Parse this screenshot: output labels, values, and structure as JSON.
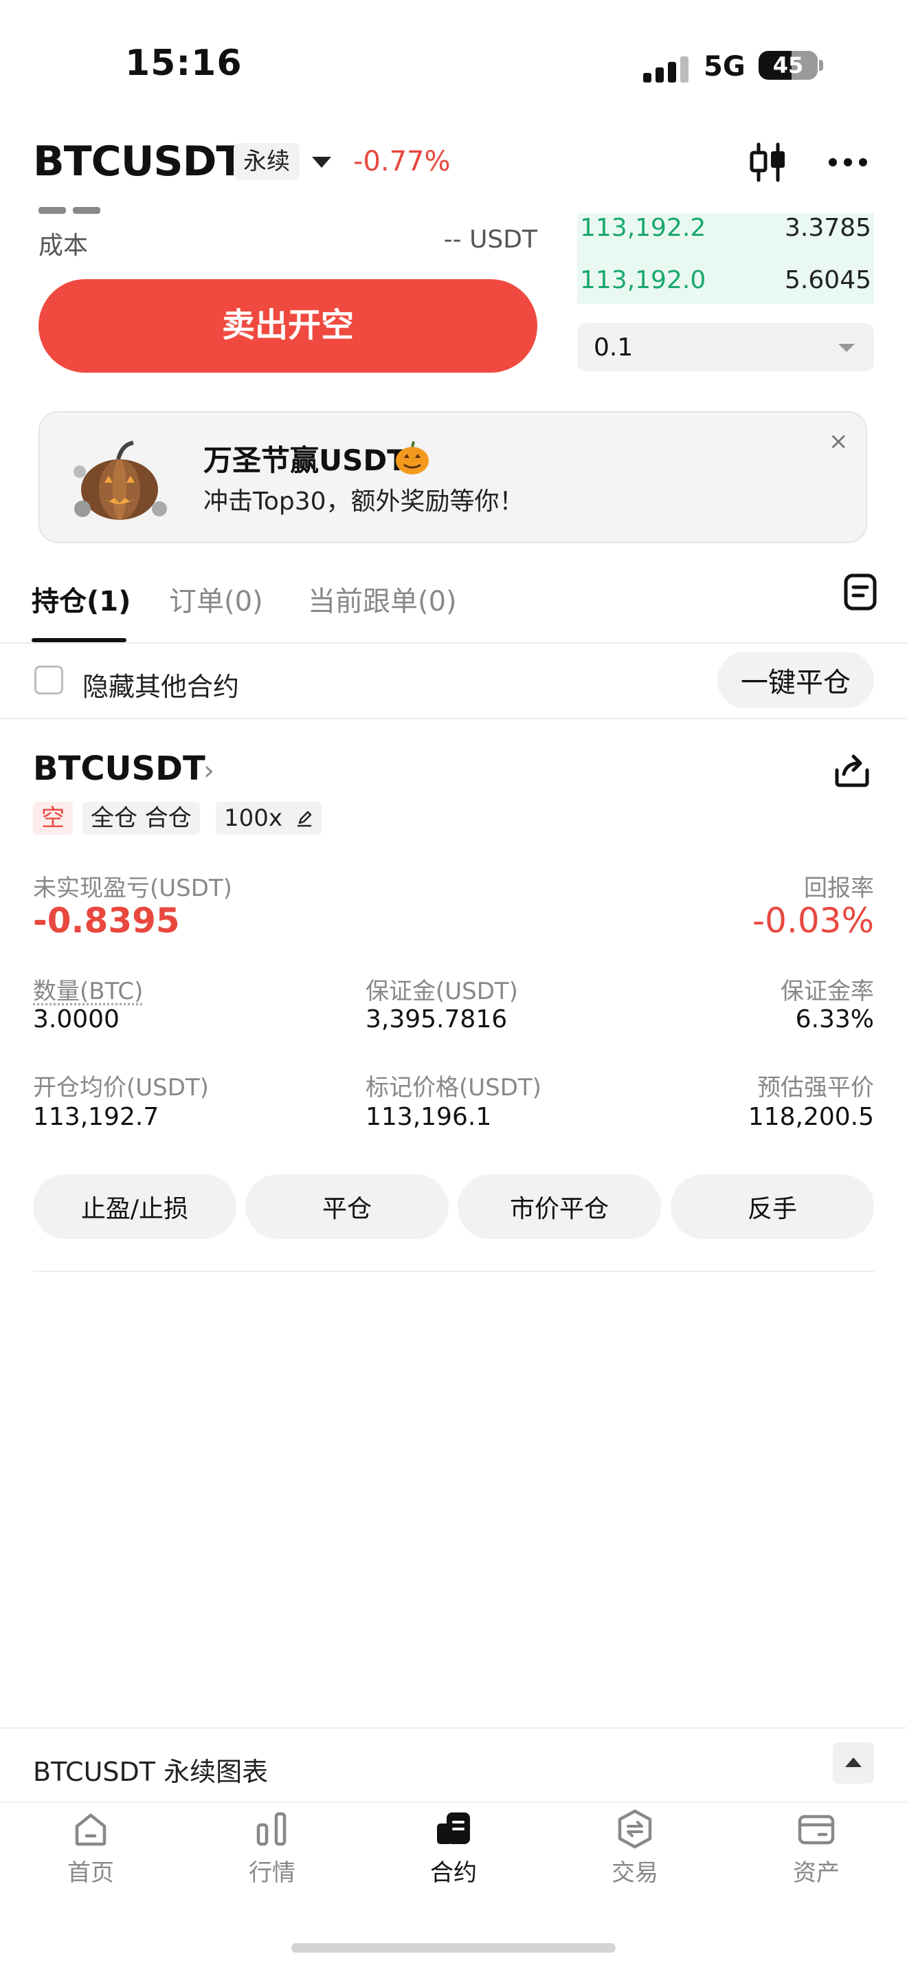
{
  "status_bar": {
    "time": "15:16",
    "network": "5G",
    "battery": "45"
  },
  "header": {
    "symbol": "BTCUSDT",
    "contract_type": "永续",
    "change": "-0.77%"
  },
  "trade_panel": {
    "cost_label": "成本",
    "cost_value": "-- USDT",
    "sell_button": "卖出开空",
    "order_book": [
      {
        "price": "113,192.2",
        "qty": "3.3785"
      },
      {
        "price": "113,192.0",
        "qty": "5.6045"
      }
    ],
    "precision_value": "0.1"
  },
  "banner": {
    "title": "万圣节赢USDT",
    "subtitle": "冲击Top30，额外奖励等你！",
    "close": "×"
  },
  "tabs": [
    {
      "label": "持仓(1)",
      "active": true
    },
    {
      "label": "订单(0)",
      "active": false
    },
    {
      "label": "当前跟单(0)",
      "active": false
    }
  ],
  "filter": {
    "hide_other_label": "隐藏其他合约",
    "close_all_button": "一键平仓"
  },
  "position": {
    "symbol": "BTCUSDT",
    "side_tag": "空",
    "mode_tag": "全仓 合仓",
    "leverage_tag": "100x",
    "unrealized_pnl_label": "未实现盈亏(USDT)",
    "unrealized_pnl_value": "-0.8395",
    "roi_label": "回报率",
    "roi_value": "-0.03%",
    "qty_label": "数量(BTC)",
    "qty_value": "3.0000",
    "margin_label": "保证金(USDT)",
    "margin_value": "3,395.7816",
    "margin_ratio_label": "保证金率",
    "margin_ratio_value": "6.33%",
    "entry_label": "开仓均价(USDT)",
    "entry_value": "113,192.7",
    "mark_label": "标记价格(USDT)",
    "mark_value": "113,196.1",
    "liq_label": "预估强平价",
    "liq_value": "118,200.5",
    "actions": [
      "止盈/止损",
      "平仓",
      "市价平仓",
      "反手"
    ]
  },
  "chart_bar": {
    "label": "BTCUSDT 永续图表"
  },
  "bottom_nav": [
    {
      "label": "首页",
      "icon": "home-icon",
      "active": false
    },
    {
      "label": "行情",
      "icon": "market-icon",
      "active": false
    },
    {
      "label": "合约",
      "icon": "futures-icon",
      "active": true
    },
    {
      "label": "交易",
      "icon": "trade-icon",
      "active": false
    },
    {
      "label": "资产",
      "icon": "wallet-icon",
      "active": false
    }
  ],
  "colors": {
    "red": "#e8483f",
    "green": "#18a86b",
    "sell_button": "#f04a40"
  }
}
